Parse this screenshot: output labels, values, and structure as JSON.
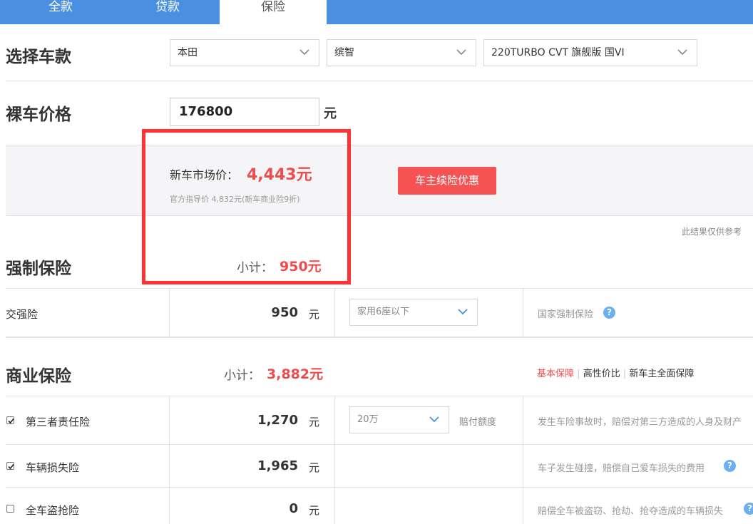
{
  "tabs": [
    {
      "label": "全款"
    },
    {
      "label": "贷款"
    },
    {
      "label": "保险"
    }
  ],
  "select_model": {
    "title": "选择车款",
    "brand": "本田",
    "series": "缤智",
    "trim": "220TURBO CVT 旗舰版 国VI"
  },
  "price": {
    "title": "裸车价格",
    "value": "176800",
    "unit": "元"
  },
  "summary": {
    "market_label": "新车市场价：",
    "market_value": "4,443元",
    "guide_note": "官方指导价 4,832元(新车商业险9折)",
    "renew_button": "车主续险优惠",
    "disclaimer": "此结果仅供参考"
  },
  "compulsory": {
    "title": "强制保险",
    "subtotal_label": "小计：",
    "subtotal_value": "950元",
    "rows": [
      {
        "name": "交强险",
        "amount": "950",
        "unit": "元",
        "option": "家用6座以下",
        "desc": "国家强制保险"
      }
    ]
  },
  "commercial": {
    "title": "商业保险",
    "subtotal_label": "小计：",
    "subtotal_value": "3,882元",
    "plans": [
      "基本保障",
      "高性价比",
      "新车主全面保障"
    ],
    "rows": [
      {
        "name": "第三者责任险",
        "checked": true,
        "amount": "1,270",
        "unit": "元",
        "option": "20万",
        "option_label": "赔付额度",
        "desc": "发生车险事故时，赔偿对第三方造成的人身及财产"
      },
      {
        "name": "车辆损失险",
        "checked": true,
        "amount": "1,965",
        "unit": "元",
        "desc": "车子发生碰撞，赔偿自己爱车损失的费用"
      },
      {
        "name": "全车盗抢险",
        "checked": false,
        "amount": "0",
        "unit": "元",
        "desc": "赔偿全车被盗窃、抢劫、抢夺造成的车辆损失"
      }
    ]
  },
  "colors": {
    "tab_bar": "#4a8fe0",
    "accent_red": "#f04c4c",
    "help_blue": "#6ab0f0"
  }
}
